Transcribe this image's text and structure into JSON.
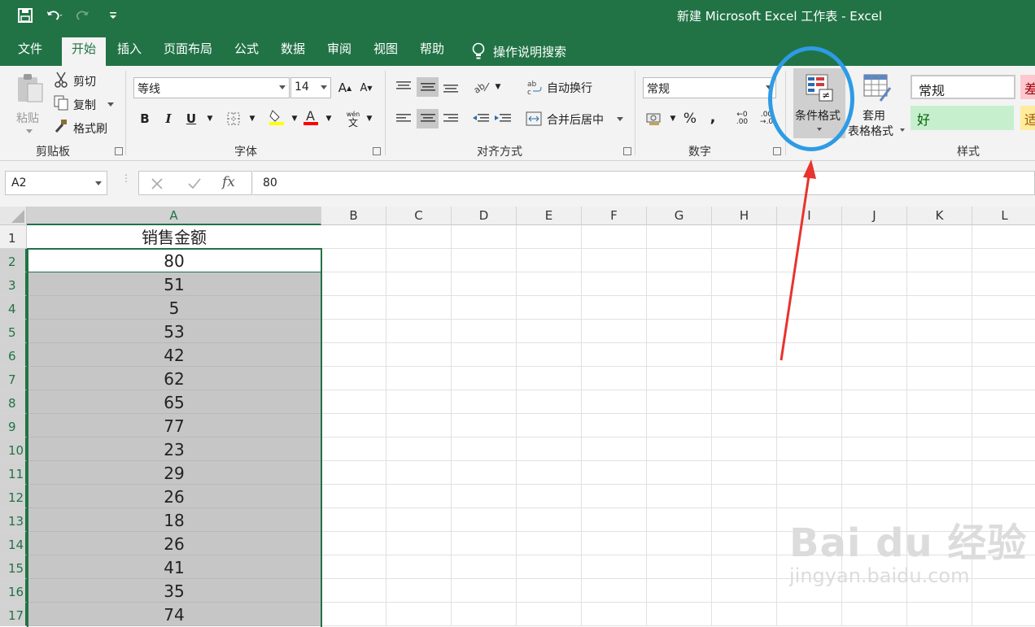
{
  "window": {
    "title": "新建 Microsoft Excel 工作表  -  Excel"
  },
  "menu": {
    "tabs": [
      "文件",
      "开始",
      "插入",
      "页面布局",
      "公式",
      "数据",
      "审阅",
      "视图",
      "帮助"
    ],
    "active": "开始",
    "tell_me": "操作说明搜索"
  },
  "ribbon": {
    "clipboard": {
      "paste": "粘贴",
      "cut": "剪切",
      "copy": "复制",
      "format_painter": "格式刷",
      "label": "剪贴板"
    },
    "font": {
      "font_name": "等线",
      "font_size": "14",
      "label": "字体",
      "phonetic": "wén\n文"
    },
    "alignment": {
      "wrap_text": "自动换行",
      "merge_center": "合并后居中",
      "label": "对齐方式"
    },
    "number": {
      "format": "常规",
      "label": "数字"
    },
    "styles": {
      "conditional_formatting": "条件格式",
      "format_as_table_line1": "套用",
      "format_as_table_line2": "表格格式",
      "cell_styles": [
        {
          "name": "常规",
          "bg": "#ffffff",
          "color": "#000000"
        },
        {
          "name": "差",
          "bg": "#ffc7ce",
          "color": "#9c0006"
        },
        {
          "name": "好",
          "bg": "#c6efce",
          "color": "#006100"
        },
        {
          "name": "适",
          "bg": "#ffeb9c",
          "color": "#9c5700"
        }
      ],
      "label": "样式"
    }
  },
  "formula_bar": {
    "name_box": "A2",
    "value": "80"
  },
  "sheet": {
    "columns": [
      "A",
      "B",
      "C",
      "D",
      "E",
      "F",
      "G",
      "H",
      "I",
      "J",
      "K",
      "L"
    ],
    "rows": [
      "1",
      "2",
      "3",
      "4",
      "5",
      "6",
      "7",
      "8",
      "9",
      "10",
      "11",
      "12",
      "13",
      "14",
      "15",
      "16",
      "17"
    ],
    "column_a": [
      "销售金额",
      "80",
      "51",
      "5",
      "53",
      "42",
      "62",
      "65",
      "77",
      "23",
      "29",
      "26",
      "18",
      "26",
      "41",
      "35",
      "74"
    ]
  },
  "watermark": {
    "brand": "Bai du 经验",
    "url": "jingyan.baidu.com"
  },
  "colors": {
    "excel_green": "#217346",
    "selection_gray": "#c6c6c6",
    "annotation_blue": "#2e9be5",
    "arrow_red": "#e8332e"
  }
}
